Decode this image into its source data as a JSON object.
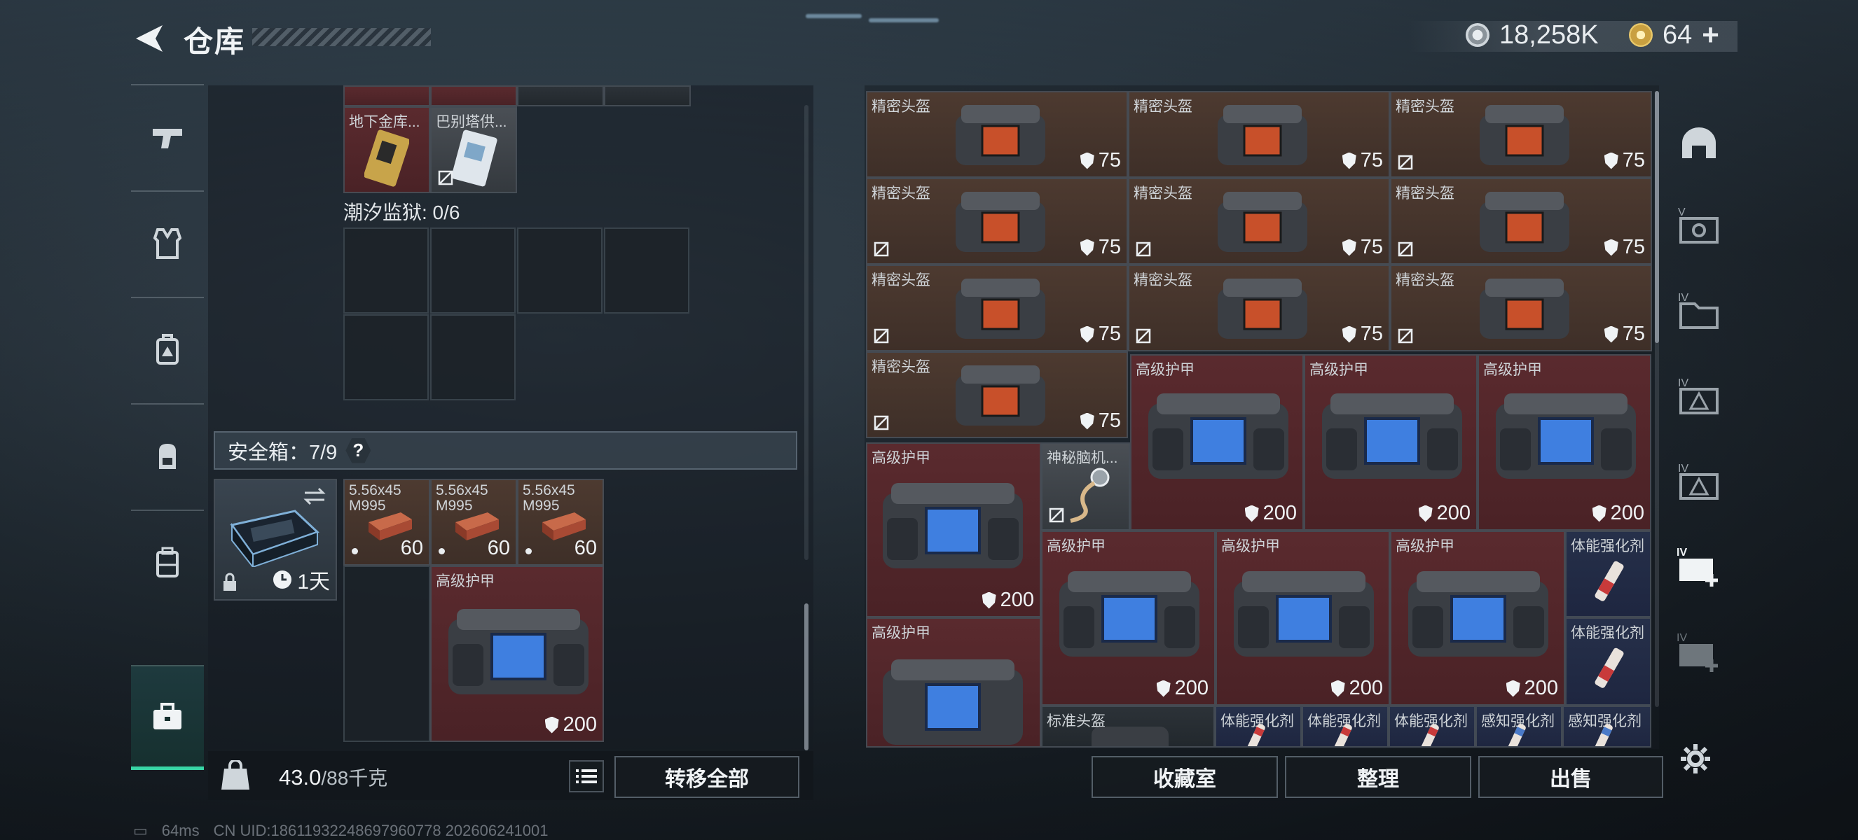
{
  "header": {
    "title": "仓库",
    "currency_1": "18,258K",
    "currency_2": "64"
  },
  "left_nav": [
    "weapon-icon",
    "armor-vest-icon",
    "backpack-tactical-icon",
    "backpack-icon",
    "storage-case-icon",
    "briefcase-icon"
  ],
  "left_panel": {
    "top_items": [
      {
        "label": "地下金库...",
        "rarity": "red"
      },
      {
        "label": "巴别塔供...",
        "rarity": "dark"
      }
    ],
    "tide_prison_label": "潮汐监狱: 0/6",
    "safebox": {
      "label": "安全箱：7/9",
      "help": "?",
      "duration": "1天",
      "ammo": [
        {
          "label": "5.56x45\nM995",
          "count": "60"
        },
        {
          "label": "5.56x45\nM995",
          "count": "60"
        },
        {
          "label": "5.56x45\nM995",
          "count": "60"
        }
      ],
      "armor": {
        "label": "高级护甲",
        "value": "200"
      }
    },
    "weight": "43.0",
    "weight_max": "/88千克",
    "transfer_all": "转移全部"
  },
  "right_panel": {
    "helmets": [
      {
        "label": "精密头盔",
        "value": "75",
        "nobind": false
      },
      {
        "label": "精密头盔",
        "value": "75",
        "nobind": false
      },
      {
        "label": "精密头盔",
        "value": "75",
        "nobind": true
      },
      {
        "label": "精密头盔",
        "value": "75",
        "nobind": true
      },
      {
        "label": "精密头盔",
        "value": "75",
        "nobind": true
      },
      {
        "label": "精密头盔",
        "value": "75",
        "nobind": true
      },
      {
        "label": "精密头盔",
        "value": "75",
        "nobind": true
      },
      {
        "label": "精密头盔",
        "value": "75",
        "nobind": true
      },
      {
        "label": "精密头盔",
        "value": "75",
        "nobind": true
      },
      {
        "label": "精密头盔",
        "value": "75",
        "nobind": true
      }
    ],
    "armors_row1": [
      {
        "label": "高级护甲",
        "value": "200"
      },
      {
        "label": "高级护甲",
        "value": "200"
      },
      {
        "label": "高级护甲",
        "value": "200"
      }
    ],
    "armor_left_1": {
      "label": "高级护甲",
      "value": "200"
    },
    "mystery": {
      "label": "神秘脑机..."
    },
    "armors_row2": [
      {
        "label": "高级护甲",
        "value": "200"
      },
      {
        "label": "高级护甲",
        "value": "200"
      },
      {
        "label": "高级护甲",
        "value": "200"
      }
    ],
    "armor_left_2": {
      "label": "高级护甲"
    },
    "stim_1": {
      "label": "体能强化剂"
    },
    "stim_2": {
      "label": "体能强化剂"
    },
    "bottom_row": [
      {
        "label": "标准头盔"
      },
      {
        "label": "体能强化剂"
      },
      {
        "label": "体能强化剂"
      },
      {
        "label": "体能强化剂"
      },
      {
        "label": "感知强化剂"
      },
      {
        "label": "感知强化剂"
      }
    ],
    "buttons": {
      "collection": "收藏室",
      "sort": "整理",
      "sell": "出售"
    }
  },
  "right_nav": [
    "helmet-slot-icon",
    "slot-v-icon",
    "slot-iv-folder-icon",
    "slot-iv-triangle-icon",
    "slot-iv-stack-icon",
    "slot-iv-add-icon",
    "slot-iv-add-disabled-icon"
  ],
  "status": {
    "ping": "64ms",
    "uid": "CN UID:18611932248697960778 202606241001"
  }
}
